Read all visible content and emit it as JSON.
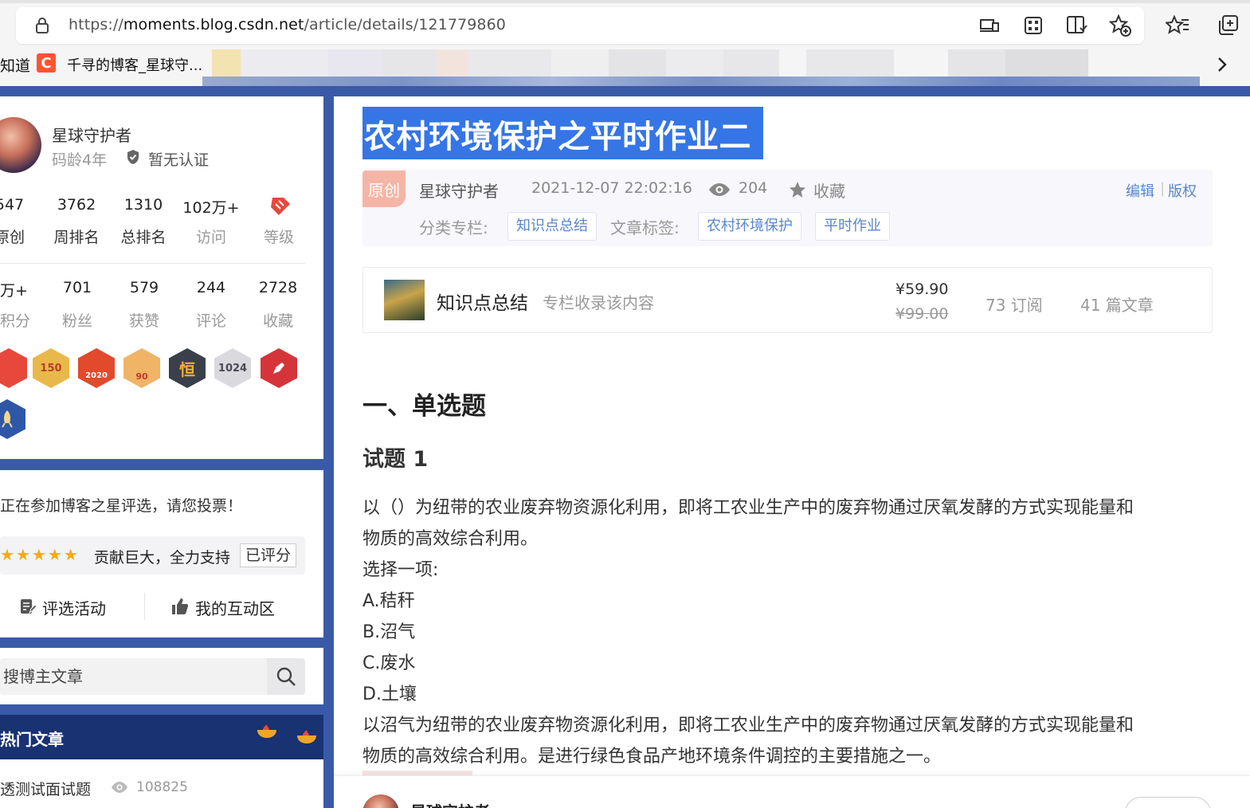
{
  "browser": {
    "url_prefix": "https://",
    "url_host": "moments.blog.csdn.net",
    "url_path": "/article/details/121779860",
    "bookmark_left_fragment": "知道",
    "bookmark_csdn_logo": "C",
    "bookmark_csdn_label": "千寻的博客_星球守...",
    "icons": [
      "lock-icon",
      "device-icon",
      "apps-icon",
      "reader-view-icon",
      "add-favorite-icon",
      "favorites-icon",
      "collections-icon",
      "chevron-right-icon"
    ]
  },
  "sidebar": {
    "profile": {
      "name": "星球守护者",
      "code_age": "码龄4年",
      "verify": "暂无认证",
      "stats_row1": [
        {
          "value": "547",
          "label": "原创"
        },
        {
          "value": "3762",
          "label": "周排名"
        },
        {
          "value": "1310",
          "label": "总排名"
        },
        {
          "value": "102万+",
          "label": "访问"
        },
        {
          "value": "",
          "label": "等级"
        }
      ],
      "stats_row2": [
        {
          "value": "万+",
          "label": "积分"
        },
        {
          "value": "701",
          "label": "粉丝"
        },
        {
          "value": "579",
          "label": "获赞"
        },
        {
          "value": "244",
          "label": "评论"
        },
        {
          "value": "2728",
          "label": "收藏"
        }
      ],
      "badges": [
        {
          "label": "",
          "color": "#e8483b"
        },
        {
          "label": "150",
          "color": "#e9b84a"
        },
        {
          "label": "2020",
          "color": "#e14a2b"
        },
        {
          "label": "90",
          "color": "#f0b466"
        },
        {
          "label": "恒",
          "color": "#3a3f4a"
        },
        {
          "label": "1024",
          "color": "#d9d9de"
        },
        {
          "label": "",
          "color": "#d5343b"
        },
        {
          "label": "",
          "color": "#2f57a8"
        }
      ]
    },
    "vote": {
      "text": "正在参加博客之星评选，请您投票！",
      "stars": "★★★★★",
      "comment": "贡献巨大，全力支持",
      "rated": "已评分",
      "activity": "评选活动",
      "interact": "我的互动区"
    },
    "search": {
      "placeholder": "搜博主文章"
    },
    "hot": {
      "title": "热门文章",
      "item_title": "透测试面试题",
      "item_views": "108825"
    }
  },
  "article": {
    "title": "农村环境保护之平时作业二",
    "original_tag": "原创",
    "author": "星球守护者",
    "date": "2021-12-07 22:02:16",
    "views": "204",
    "favorite": "收藏",
    "edit": "编辑",
    "sep": "|",
    "copyright": "版权",
    "category_label": "分类专栏:",
    "category": "知识点总结",
    "tags_label": "文章标签:",
    "tags": [
      "农村环境保护",
      "平时作业"
    ],
    "column": {
      "name": "知识点总结",
      "desc": "专栏收录该内容",
      "price": "¥59.90",
      "old_price": "¥99.00",
      "subscriptions": "73 订阅",
      "count": "41 篇文章"
    },
    "heading1": "一、单选题",
    "heading2": "试题 1",
    "lines": [
      "以（）为纽带的农业废弃物资源化利用，即将工农业生产中的废弃物通过厌氧发酵的方式实现能量和",
      "物质的高效综合利用。",
      "选择一项:",
      "A.秸秆",
      "B.沼气",
      "C.废水",
      "D.土壤",
      "以沼气为纽带的农业废弃物资源化利用，即将工农业生产中的废弃物通过厌氧发酵的方式实现能量和",
      "物质的高效综合利用。是进行绿色食品产地环境条件调控的主要措施之一。"
    ],
    "bottom_author": "星球守护者"
  }
}
